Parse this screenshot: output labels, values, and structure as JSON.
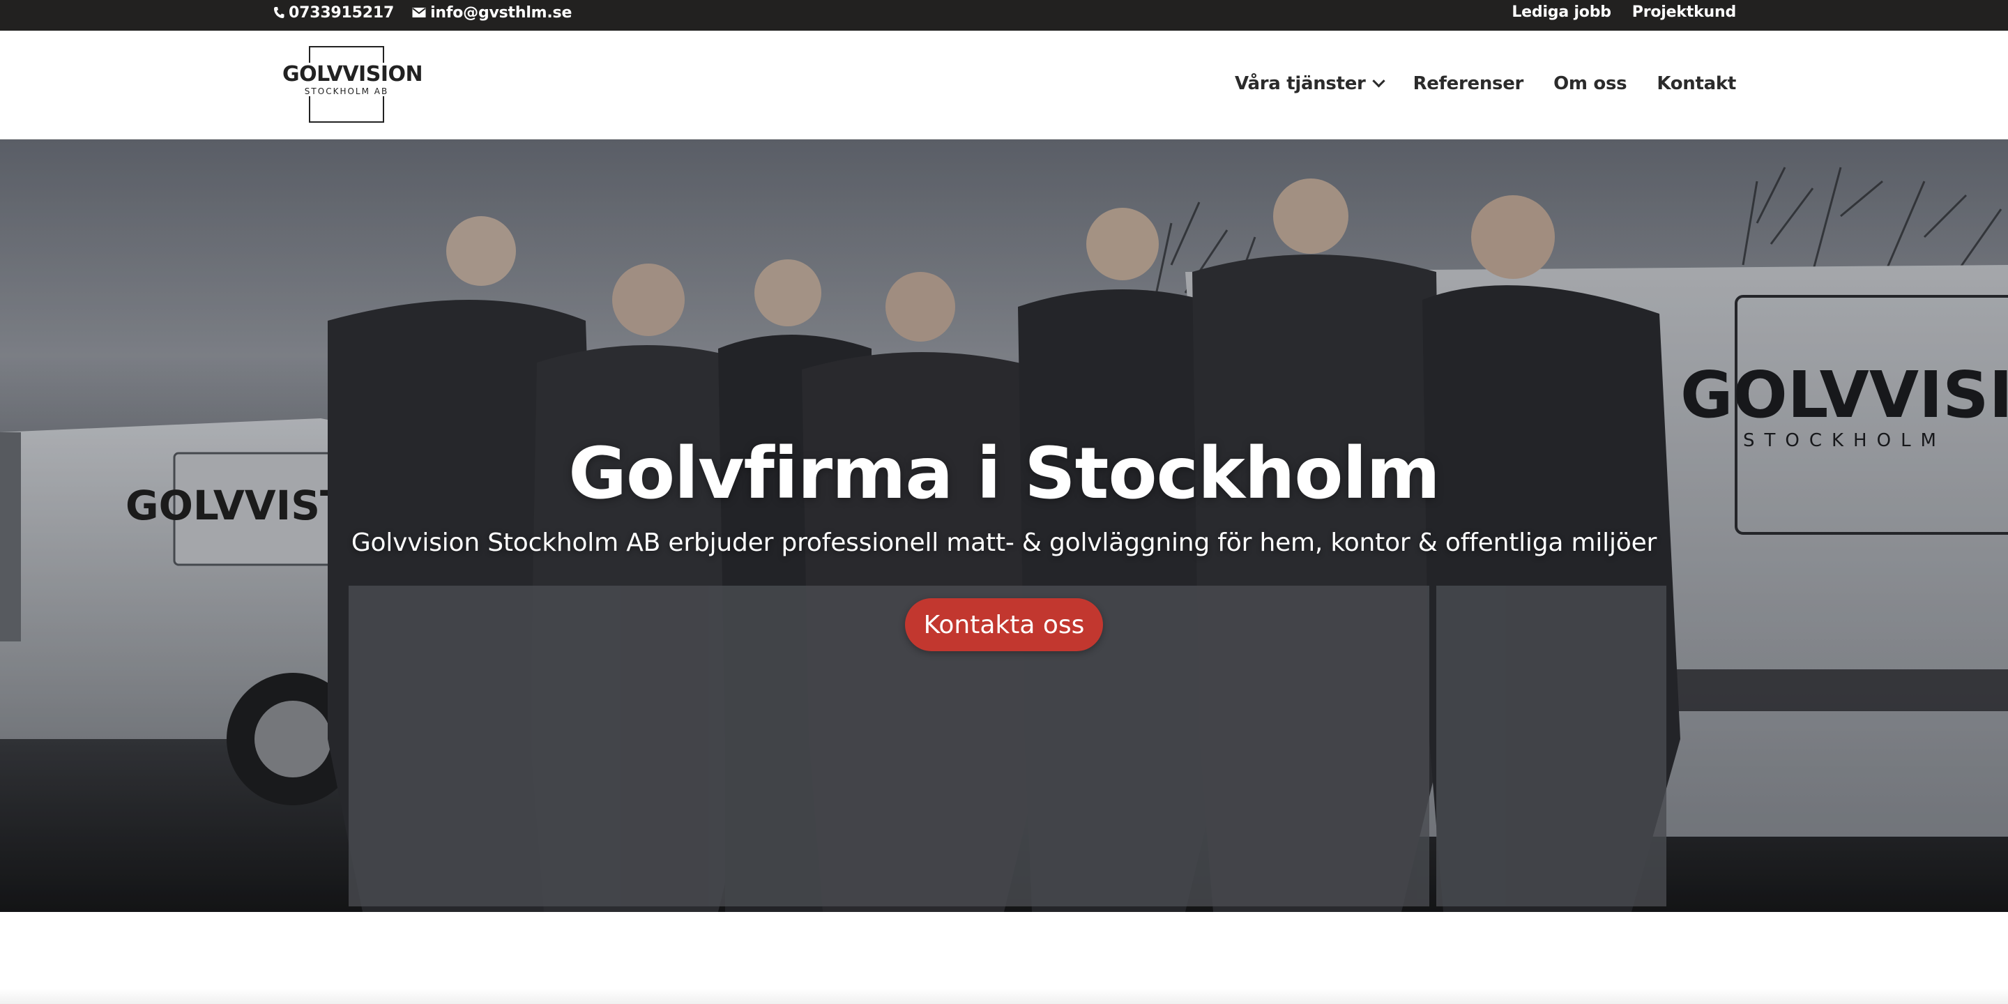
{
  "topbar": {
    "phone": "0733915217",
    "email": "info@gvsthlm.se",
    "links": [
      "Lediga jobb",
      "Projektkund"
    ]
  },
  "header": {
    "logo": {
      "name": "GOLVVISION",
      "sub": "STOCKHOLM AB"
    },
    "nav": [
      {
        "label": "Våra tjänster",
        "has_dropdown": true
      },
      {
        "label": "Referenser",
        "has_dropdown": false
      },
      {
        "label": "Om oss",
        "has_dropdown": false
      },
      {
        "label": "Kontakt",
        "has_dropdown": false
      }
    ]
  },
  "hero": {
    "title": "Golvfirma i Stockholm",
    "subtitle": "Golvvision Stockholm AB erbjuder professionell matt- & golvläggning för hem, kontor & offentliga miljöer",
    "cta_label": "Kontakta oss",
    "van_text": "GOLVVISI",
    "van_text_sub": "STOCKHOLM",
    "van_text_left": "GOLVVIST"
  },
  "colors": {
    "topbar_bg": "#222120",
    "cta_bg": "#c2372f",
    "nav_text": "#2b2b2b"
  },
  "icons": [
    "phone-icon",
    "mail-icon",
    "chevron-down-icon"
  ]
}
